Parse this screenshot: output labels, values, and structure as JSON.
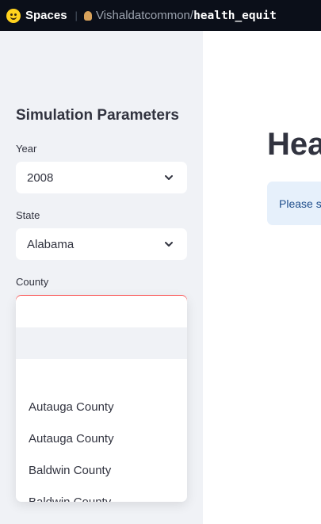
{
  "topbar": {
    "spaces_label": "Spaces",
    "owner": "Vishaldatcommon",
    "slash": "/",
    "repo": "health_equit"
  },
  "sidebar": {
    "title": "Simulation Parameters",
    "year": {
      "label": "Year",
      "value": "2008"
    },
    "state": {
      "label": "State",
      "value": "Alabama"
    },
    "county": {
      "label": "County",
      "value": "",
      "options": [
        "",
        "",
        "Autauga County",
        "Autauga County",
        "Baldwin County",
        "Baldwin County"
      ]
    }
  },
  "main": {
    "title": "Hea",
    "info_text": "Please s"
  },
  "colors": {
    "topbar_bg": "#0b0f19",
    "sidebar_bg": "#f0f2f6",
    "focus_border": "#ff4b4b",
    "info_bg": "#e6f0fb",
    "text": "#31333f"
  }
}
